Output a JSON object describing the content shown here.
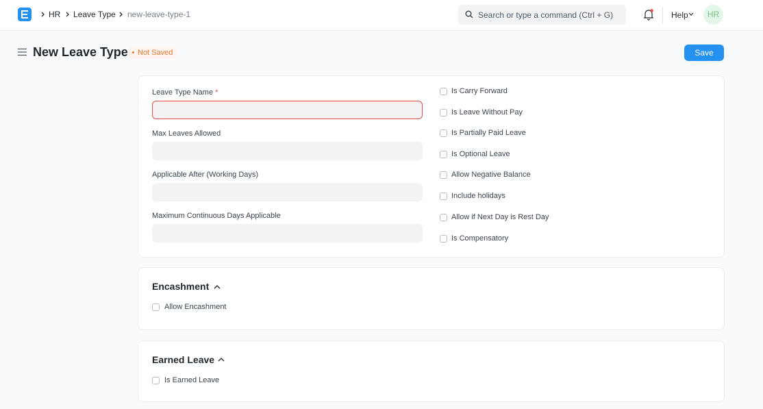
{
  "breadcrumbs": [
    "HR",
    "Leave Type",
    "new-leave-type-1"
  ],
  "search": {
    "placeholder": "Search or type a command (Ctrl + G)"
  },
  "help_label": "Help",
  "avatar_initials": "HR",
  "page": {
    "title": "New Leave Type",
    "status": "Not Saved",
    "save_label": "Save"
  },
  "main_fields": [
    {
      "label": "Leave Type Name",
      "required": "*",
      "value": ""
    },
    {
      "label": "Max Leaves Allowed",
      "value": ""
    },
    {
      "label": "Applicable After (Working Days)",
      "value": ""
    },
    {
      "label": "Maximum Continuous Days Applicable",
      "value": ""
    }
  ],
  "checkboxes": [
    "Is Carry Forward",
    "Is Leave Without Pay",
    "Is Partially Paid Leave",
    "Is Optional Leave",
    "Allow Negative Balance",
    "Include holidays",
    "Allow if Next Day is Rest Day",
    "Is Compensatory"
  ],
  "encashment": {
    "title": "Encashment",
    "checkbox": "Allow Encashment"
  },
  "earned_leave": {
    "title": "Earned Leave",
    "checkbox": "Is Earned Leave"
  },
  "colors": {
    "accent": "#2490ef",
    "error": "#e24c4c",
    "status": "#e2762d"
  }
}
